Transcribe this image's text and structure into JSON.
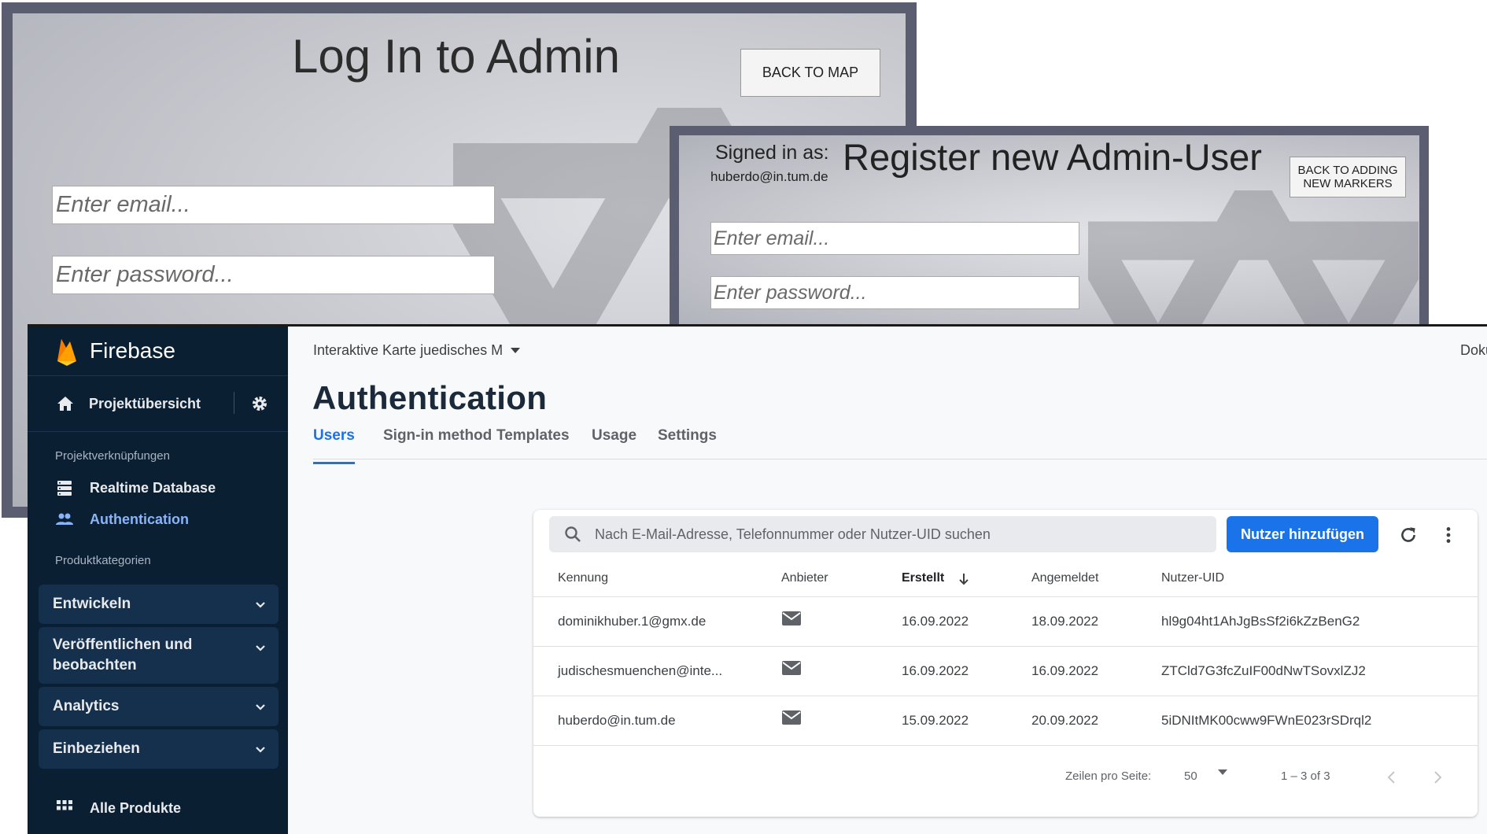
{
  "login": {
    "title": "Log In to Admin",
    "back_to_map": "BACK TO MAP",
    "email_placeholder": "Enter email...",
    "password_placeholder": "Enter password..."
  },
  "register": {
    "signed_in_label": "Signed in as:",
    "signed_in_email": "huberdo@in.tum.de",
    "title": "Register new Admin-User",
    "back_button_line1": "BACK TO ADDING",
    "back_button_line2": "NEW MARKERS",
    "email_placeholder": "Enter email...",
    "password_placeholder": "Enter password..."
  },
  "sidebar": {
    "brand": "Firebase",
    "overview": "Projektübersicht",
    "section_links": "Projektverknüpfungen",
    "links": [
      {
        "label": "Realtime Database",
        "icon": "database-icon"
      },
      {
        "label": "Authentication",
        "icon": "users-icon",
        "active": true
      }
    ],
    "section_categories": "Produktkategorien",
    "categories": [
      {
        "label": "Entwickeln"
      },
      {
        "label": "Veröffentlichen und beobachten"
      },
      {
        "label": "Analytics"
      },
      {
        "label": "Einbeziehen"
      }
    ],
    "all_products": "Alle Produkte"
  },
  "header": {
    "project": "Interaktive Karte juedisches M",
    "docs": "Doku",
    "title": "Authentication"
  },
  "tabs": [
    "Users",
    "Sign-in method",
    "Templates",
    "Usage",
    "Settings"
  ],
  "users": {
    "search_placeholder": "Nach E-Mail-Adresse, Telefonnummer oder Nutzer-UID suchen",
    "add_button": "Nutzer hinzufügen",
    "columns": [
      "Kennung",
      "Anbieter",
      "Erstellt",
      "Angemeldet",
      "Nutzer-UID"
    ],
    "rows": [
      {
        "id": "dominikhuber.1@gmx.de",
        "created": "16.09.2022",
        "signed_in": "18.09.2022",
        "uid": "hl9g04ht1AhJgBsSf2i6kZzBenG2"
      },
      {
        "id": "judischesmuenchen@inte...",
        "created": "16.09.2022",
        "signed_in": "16.09.2022",
        "uid": "ZTCld7G3fcZuIF00dNwTSovxlZJ2"
      },
      {
        "id": "huberdo@in.tum.de",
        "created": "15.09.2022",
        "signed_in": "20.09.2022",
        "uid": "5iDNItMK00cww9FWnE023rSDrql2"
      }
    ],
    "rows_per_page_label": "Zeilen pro Seite:",
    "rows_per_page": "50",
    "range": "1 – 3 of 3"
  },
  "colors": {
    "sidebar_bg": "#0b1f33",
    "accent": "#1a73e8",
    "active_link": "#8ab4f8"
  }
}
